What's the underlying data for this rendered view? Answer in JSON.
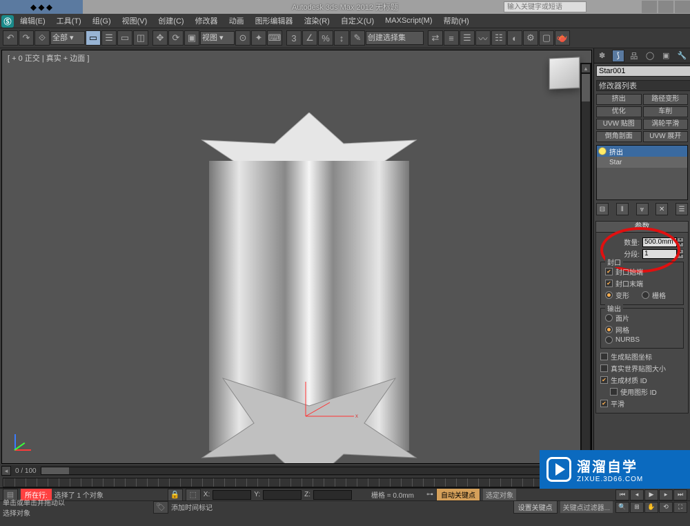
{
  "title_bar": {
    "app_title": "Autodesk 3ds Max 2012     无标题",
    "search_placeholder": "输入关键字或短语"
  },
  "menu": {
    "items": [
      "编辑(E)",
      "工具(T)",
      "组(G)",
      "视图(V)",
      "创建(C)",
      "修改器",
      "动画",
      "图形编辑器",
      "渲染(R)",
      "自定义(U)",
      "MAXScript(M)",
      "帮助(H)"
    ]
  },
  "toolbar": {
    "select_set_label": "全部 ▾",
    "view_label": "视图 ▾",
    "create_set_label": "创建选择集"
  },
  "viewport": {
    "label": "[ + 0 正交 | 真实 + 边面 ]",
    "slider_text": "0 / 100"
  },
  "right_panel": {
    "object_name": "Star001",
    "modifier_dropdown": "修改器列表",
    "mod_buttons": [
      "挤出",
      "路径变形",
      "优化",
      "车削",
      "UVW 贴图",
      "涡轮平滑",
      "倒角剖面",
      "UVW 展开"
    ],
    "stack": [
      {
        "label": "挤出",
        "selected": true
      },
      {
        "label": "Star",
        "selected": false
      }
    ],
    "params": {
      "title": "参数",
      "amount_label": "数量:",
      "amount_value": "500.0mm",
      "segments_label": "分段:",
      "segments_value": "1",
      "cap_group": "封口",
      "cap_start": "封口始端",
      "cap_end": "封口末端",
      "deform": "变形",
      "grid": "栅格",
      "output_group": "输出",
      "out_patch": "面片",
      "out_mesh": "网格",
      "out_nurbs": "NURBS",
      "gen_map": "生成贴图坐标",
      "real_world": "真实世界贴图大小",
      "gen_mat": "生成材质 ID",
      "use_shape": "使用图形 ID",
      "smooth": "平滑"
    }
  },
  "status": {
    "row1_left": "选择了 1 个对象",
    "row2_left": "单击或单击并拖动以选择对象",
    "add_time_tag": "添加时间标记",
    "x_label": "X:",
    "y_label": "Y:",
    "z_label": "Z:",
    "grid_label": "栅格 = 0.0mm",
    "auto_key": "自动关键点",
    "sel_obj": "选定对象",
    "set_key": "设置关键点",
    "key_filter": "关键点过滤器...",
    "current_tag": "所在行:"
  },
  "watermark": {
    "big": "溜溜自学",
    "small": "ZIXUE.3D66.COM"
  }
}
